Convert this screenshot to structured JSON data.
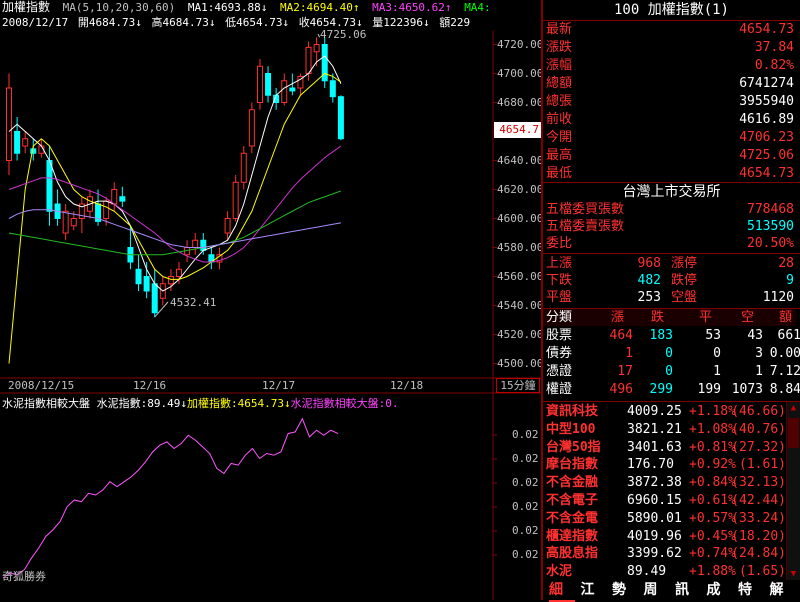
{
  "header": {
    "title": "加權指數",
    "ma_params": "MA(5,10,20,30,60)",
    "ma1": "MA1:4693.88↓",
    "ma2": "MA2:4694.40↑",
    "ma3": "MA3:4650.62↑",
    "ma4": "MA4:",
    "date": "2008/12/17",
    "open": "開4684.73↓",
    "high": "高4684.73↓",
    "low": "低4654.73↓",
    "close": "收4654.73↓",
    "volume": "量122396↓",
    "amount": "額229"
  },
  "price_axis": {
    "ticks": [
      "4720.00",
      "4700.00",
      "4680.00",
      "4660.00",
      "4640.00",
      "4620.00",
      "4600.00",
      "4580.00",
      "4560.00",
      "4540.00",
      "4520.00",
      "4500.00"
    ],
    "current_price": "4654.7",
    "high_annotation": "4725.06",
    "low_annotation": "4532.41"
  },
  "time_axis": {
    "labels": [
      "2008/12/15",
      "12/16",
      "12/17",
      "12/18"
    ],
    "interval": "15分鐘"
  },
  "sub_chart": {
    "title": "水泥指數相較大盤",
    "cement_label": "水泥指數:89.49↓",
    "index_label": "加權指數:4654.73↓",
    "compare_label": "水泥指數相較大盤:0.",
    "ticks": [
      "0.02",
      "0.02",
      "0.02",
      "0.02",
      "0.02",
      "0.02"
    ],
    "watermark": "奇狐勝券"
  },
  "quote_panel": {
    "header": "100 加權指數(1)",
    "rows": [
      {
        "label": "最新",
        "value": "4654.73",
        "color": "#ff3030"
      },
      {
        "label": "漲跌",
        "value": "37.84",
        "color": "#ff3030"
      },
      {
        "label": "漲幅",
        "value": "0.82%",
        "color": "#ff3030"
      },
      {
        "label": "總額",
        "value": "6741274",
        "color": "#ffffff"
      },
      {
        "label": "總張",
        "value": "3955940",
        "color": "#ffffff"
      },
      {
        "label": "前收",
        "value": "4616.89",
        "color": "#ffffff"
      },
      {
        "label": "今開",
        "value": "4706.23",
        "color": "#ff3030"
      },
      {
        "label": "最高",
        "value": "4725.06",
        "color": "#ff3030"
      },
      {
        "label": "最低",
        "value": "4654.73",
        "color": "#ff3030"
      }
    ],
    "exchange_title": "台灣上市交易所",
    "exchange_rows": [
      {
        "label": "五檔委買張數",
        "value": "778468",
        "color": "#ff3030"
      },
      {
        "label": "五檔委賣張數",
        "value": "513590",
        "color": "#00ffff"
      },
      {
        "label": "委比",
        "value": "20.50%",
        "color": "#ff3030"
      }
    ],
    "advance": {
      "up_label": "上漲",
      "up": "968",
      "limit_up_label": "漲停",
      "limit_up": "28",
      "down_label": "下跌",
      "down": "482",
      "limit_down_label": "跌停",
      "limit_down": "9",
      "flat_label": "平盤",
      "flat": "253",
      "no_trade_label": "空盤",
      "no_trade": "1120"
    },
    "breadth_headers": [
      "分類",
      "漲",
      "跌",
      "平",
      "空",
      "額"
    ],
    "breadth_rows": [
      {
        "name": "股票",
        "up": "464",
        "down": "183",
        "flat": "53",
        "none": "43",
        "amt": "661"
      },
      {
        "name": "債券",
        "up": "1",
        "down": "0",
        "flat": "0",
        "none": "3",
        "amt": "0.00"
      },
      {
        "name": "憑證",
        "up": "17",
        "down": "0",
        "flat": "1",
        "none": "1",
        "amt": "7.12"
      },
      {
        "name": "權證",
        "up": "496",
        "down": "299",
        "flat": "199",
        "none": "1073",
        "amt": "8.84"
      }
    ],
    "sector_rows": [
      {
        "name": "資訊科技",
        "price": "4009.25",
        "chg": "+1.18%",
        "share": "46.66"
      },
      {
        "name": "中型100",
        "price": "3821.21",
        "chg": "+1.08%",
        "share": "40.76"
      },
      {
        "name": "台灣50指",
        "price": "3401.63",
        "chg": "+0.81%",
        "share": "27.32"
      },
      {
        "name": "摩台指數",
        "price": "176.70",
        "chg": "+0.92%",
        "share": "1.61"
      },
      {
        "name": "不含金融",
        "price": "3872.38",
        "chg": "+0.84%",
        "share": "32.13"
      },
      {
        "name": "不含電子",
        "price": "6960.15",
        "chg": "+0.61%",
        "share": "42.44"
      },
      {
        "name": "不含金電",
        "price": "5890.01",
        "chg": "+0.57%",
        "share": "33.24"
      },
      {
        "name": "櫃達指數",
        "price": "4019.96",
        "chg": "+0.45%",
        "share": "18.20"
      },
      {
        "name": "高股息指",
        "price": "3399.62",
        "chg": "+0.74%",
        "share": "24.84"
      },
      {
        "name": "水泥",
        "price": "89.49",
        "chg": "+1.88%",
        "share": "1.65"
      }
    ],
    "tabs": [
      "細",
      "江",
      "勢",
      "周",
      "訊",
      "成",
      "特",
      "解"
    ]
  },
  "colors": {
    "up": "#ff3030",
    "down": "#00ffff",
    "ma_white": "#ffffff",
    "ma_yellow": "#ffff00",
    "ma_magenta": "#cc33cc",
    "ma_green": "#22bb22",
    "ma_violet": "#aa88ff",
    "line_sub": "#ff55ff"
  },
  "chart_data": [
    {
      "type": "candlestick",
      "title": "加權指數",
      "ylim": [
        4490,
        4730
      ],
      "x_labels": [
        "2008/12/15",
        "12/16",
        "12/17",
        "12/18"
      ],
      "candles": [
        {
          "o": 4640,
          "h": 4700,
          "l": 4630,
          "c": 4690
        },
        {
          "o": 4660,
          "h": 4670,
          "l": 4640,
          "c": 4645
        },
        {
          "o": 4650,
          "h": 4660,
          "l": 4645,
          "c": 4655
        },
        {
          "o": 4648,
          "h": 4655,
          "l": 4640,
          "c": 4645
        },
        {
          "o": 4645,
          "h": 4655,
          "l": 4642,
          "c": 4650
        },
        {
          "o": 4640,
          "h": 4650,
          "l": 4595,
          "c": 4605
        },
        {
          "o": 4610,
          "h": 4620,
          "l": 4595,
          "c": 4600
        },
        {
          "o": 4590,
          "h": 4610,
          "l": 4585,
          "c": 4605
        },
        {
          "o": 4595,
          "h": 4605,
          "l": 4592,
          "c": 4600
        },
        {
          "o": 4600,
          "h": 4615,
          "l": 4590,
          "c": 4610
        },
        {
          "o": 4605,
          "h": 4620,
          "l": 4600,
          "c": 4615
        },
        {
          "o": 4610,
          "h": 4620,
          "l": 4595,
          "c": 4598
        },
        {
          "o": 4600,
          "h": 4615,
          "l": 4595,
          "c": 4612
        },
        {
          "o": 4610,
          "h": 4625,
          "l": 4605,
          "c": 4620
        },
        {
          "o": 4615,
          "h": 4622,
          "l": 4608,
          "c": 4612
        },
        {
          "o": 4580,
          "h": 4595,
          "l": 4565,
          "c": 4570
        },
        {
          "o": 4565,
          "h": 4575,
          "l": 4550,
          "c": 4555
        },
        {
          "o": 4560,
          "h": 4570,
          "l": 4545,
          "c": 4550
        },
        {
          "o": 4555,
          "h": 4565,
          "l": 4532,
          "c": 4535
        },
        {
          "o": 4545,
          "h": 4560,
          "l": 4540,
          "c": 4555
        },
        {
          "o": 4555,
          "h": 4565,
          "l": 4550,
          "c": 4560
        },
        {
          "o": 4560,
          "h": 4570,
          "l": 4555,
          "c": 4565
        },
        {
          "o": 4575,
          "h": 4585,
          "l": 4570,
          "c": 4580
        },
        {
          "o": 4580,
          "h": 4590,
          "l": 4575,
          "c": 4585
        },
        {
          "o": 4585,
          "h": 4590,
          "l": 4575,
          "c": 4578
        },
        {
          "o": 4575,
          "h": 4580,
          "l": 4565,
          "c": 4570
        },
        {
          "o": 4570,
          "h": 4580,
          "l": 4565,
          "c": 4575
        },
        {
          "o": 4590,
          "h": 4605,
          "l": 4585,
          "c": 4600
        },
        {
          "o": 4600,
          "h": 4630,
          "l": 4598,
          "c": 4625
        },
        {
          "o": 4625,
          "h": 4650,
          "l": 4620,
          "c": 4645
        },
        {
          "o": 4650,
          "h": 4680,
          "l": 4645,
          "c": 4675
        },
        {
          "o": 4680,
          "h": 4710,
          "l": 4675,
          "c": 4705
        },
        {
          "o": 4700,
          "h": 4705,
          "l": 4680,
          "c": 4685
        },
        {
          "o": 4685,
          "h": 4690,
          "l": 4675,
          "c": 4680
        },
        {
          "o": 4680,
          "h": 4700,
          "l": 4678,
          "c": 4695
        },
        {
          "o": 4690,
          "h": 4700,
          "l": 4685,
          "c": 4688
        },
        {
          "o": 4690,
          "h": 4700,
          "l": 4685,
          "c": 4698
        },
        {
          "o": 4700,
          "h": 4722,
          "l": 4695,
          "c": 4718
        },
        {
          "o": 4715,
          "h": 4725,
          "l": 4705,
          "c": 4720
        },
        {
          "o": 4720,
          "h": 4725,
          "l": 4690,
          "c": 4695
        },
        {
          "o": 4695,
          "h": 4700,
          "l": 4680,
          "c": 4684
        },
        {
          "o": 4684,
          "h": 4685,
          "l": 4654,
          "c": 4655
        }
      ],
      "ma_series": [
        {
          "name": "MA1",
          "color": "#ffffff",
          "values": [
            4660,
            4665,
            4660,
            4655,
            4650,
            4640,
            4625,
            4615,
            4610,
            4608,
            4610,
            4612,
            4612,
            4610,
            4605,
            4595,
            4580,
            4565,
            4555,
            4550,
            4553,
            4558,
            4565,
            4572,
            4578,
            4580,
            4582,
            4585,
            4595,
            4610,
            4630,
            4650,
            4670,
            4685,
            4690,
            4693,
            4696,
            4700,
            4708,
            4712,
            4705,
            4693
          ]
        },
        {
          "name": "MA2",
          "color": "#ffff00",
          "values": [
            4500,
            4560,
            4620,
            4650,
            4655,
            4650,
            4640,
            4630,
            4620,
            4615,
            4612,
            4610,
            4608,
            4605,
            4600,
            4595,
            4585,
            4575,
            4565,
            4560,
            4558,
            4558,
            4560,
            4563,
            4566,
            4570,
            4574,
            4578,
            4585,
            4595,
            4605,
            4620,
            4635,
            4650,
            4665,
            4675,
            4685,
            4690,
            4695,
            4700,
            4698,
            4694
          ]
        },
        {
          "name": "MA3",
          "color": "#cc33cc",
          "values": [
            4620,
            4622,
            4624,
            4626,
            4628,
            4628,
            4627,
            4625,
            4623,
            4621,
            4619,
            4617,
            4614,
            4610,
            4606,
            4602,
            4598,
            4594,
            4590,
            4585,
            4580,
            4577,
            4574,
            4572,
            4570,
            4570,
            4571,
            4573,
            4576,
            4580,
            4586,
            4593,
            4600,
            4607,
            4614,
            4621,
            4627,
            4632,
            4637,
            4642,
            4646,
            4650
          ]
        },
        {
          "name": "MA4",
          "color": "#22bb22",
          "values": [
            4590,
            4589,
            4588,
            4587,
            4586,
            4585,
            4584,
            4583,
            4582,
            4581,
            4580,
            4579,
            4578,
            4577,
            4576,
            4575,
            4575,
            4575,
            4575,
            4575,
            4576,
            4577,
            4578,
            4579,
            4580,
            4581,
            4582,
            4583,
            4585,
            4587,
            4590,
            4593,
            4596,
            4599,
            4602,
            4605,
            4608,
            4611,
            4613,
            4615,
            4617,
            4619
          ]
        },
        {
          "name": "MA5",
          "color": "#aa88ff",
          "values": [
            4600,
            4603,
            4605,
            4606,
            4606,
            4606,
            4605,
            4604,
            4603,
            4602,
            4601,
            4600,
            4598,
            4596,
            4594,
            4592,
            4590,
            4588,
            4586,
            4584,
            4582,
            4581,
            4580,
            4580,
            4580,
            4581,
            4582,
            4583,
            4584,
            4585,
            4586,
            4587,
            4588,
            4589,
            4590,
            4591,
            4592,
            4593,
            4594,
            4595,
            4596,
            4597
          ]
        }
      ]
    },
    {
      "type": "line",
      "title": "水泥指數相較大盤",
      "series": [
        {
          "name": "水泥指數相較大盤",
          "values": [
            0,
            0.3,
            0.2,
            0.5,
            1.2,
            1.8,
            2.5,
            2.9,
            3.4,
            4.3,
            4.7,
            4.6,
            5.1,
            5.0,
            5.3,
            5.8,
            5.5,
            5.8,
            6.1,
            6.5,
            7.0,
            7.6,
            8.0,
            8.2,
            7.8,
            8.1,
            8.6,
            8.3,
            7.9,
            7.5,
            6.6,
            6.3,
            6.9,
            6.8,
            7.4,
            7.8,
            7.2,
            7.5,
            7.4,
            7.6,
            8.7,
            8.8,
            9.6,
            8.5,
            8.9,
            8.6,
            8.9,
            8.7
          ]
        }
      ]
    }
  ]
}
